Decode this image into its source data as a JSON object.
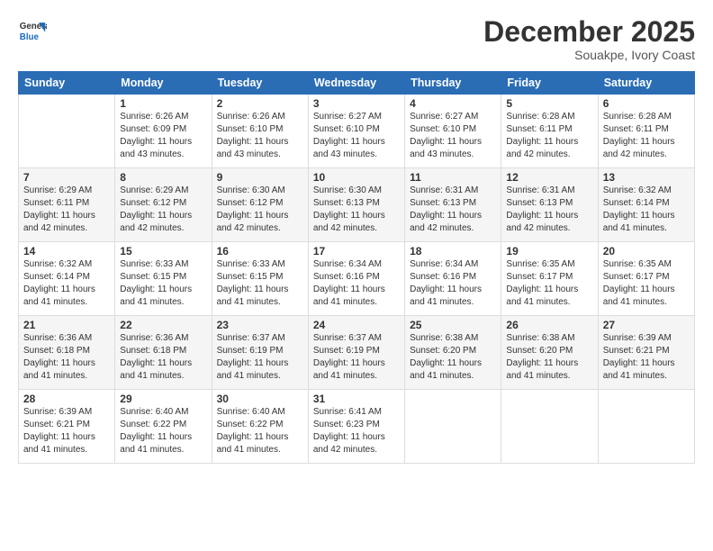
{
  "logo": {
    "general": "General",
    "blue": "Blue"
  },
  "title": "December 2025",
  "subtitle": "Souakpe, Ivory Coast",
  "headers": [
    "Sunday",
    "Monday",
    "Tuesday",
    "Wednesday",
    "Thursday",
    "Friday",
    "Saturday"
  ],
  "weeks": [
    [
      {
        "day": "",
        "info": ""
      },
      {
        "day": "1",
        "info": "Sunrise: 6:26 AM\nSunset: 6:09 PM\nDaylight: 11 hours\nand 43 minutes."
      },
      {
        "day": "2",
        "info": "Sunrise: 6:26 AM\nSunset: 6:10 PM\nDaylight: 11 hours\nand 43 minutes."
      },
      {
        "day": "3",
        "info": "Sunrise: 6:27 AM\nSunset: 6:10 PM\nDaylight: 11 hours\nand 43 minutes."
      },
      {
        "day": "4",
        "info": "Sunrise: 6:27 AM\nSunset: 6:10 PM\nDaylight: 11 hours\nand 43 minutes."
      },
      {
        "day": "5",
        "info": "Sunrise: 6:28 AM\nSunset: 6:11 PM\nDaylight: 11 hours\nand 42 minutes."
      },
      {
        "day": "6",
        "info": "Sunrise: 6:28 AM\nSunset: 6:11 PM\nDaylight: 11 hours\nand 42 minutes."
      }
    ],
    [
      {
        "day": "7",
        "info": "Sunrise: 6:29 AM\nSunset: 6:11 PM\nDaylight: 11 hours\nand 42 minutes."
      },
      {
        "day": "8",
        "info": "Sunrise: 6:29 AM\nSunset: 6:12 PM\nDaylight: 11 hours\nand 42 minutes."
      },
      {
        "day": "9",
        "info": "Sunrise: 6:30 AM\nSunset: 6:12 PM\nDaylight: 11 hours\nand 42 minutes."
      },
      {
        "day": "10",
        "info": "Sunrise: 6:30 AM\nSunset: 6:13 PM\nDaylight: 11 hours\nand 42 minutes."
      },
      {
        "day": "11",
        "info": "Sunrise: 6:31 AM\nSunset: 6:13 PM\nDaylight: 11 hours\nand 42 minutes."
      },
      {
        "day": "12",
        "info": "Sunrise: 6:31 AM\nSunset: 6:13 PM\nDaylight: 11 hours\nand 42 minutes."
      },
      {
        "day": "13",
        "info": "Sunrise: 6:32 AM\nSunset: 6:14 PM\nDaylight: 11 hours\nand 41 minutes."
      }
    ],
    [
      {
        "day": "14",
        "info": "Sunrise: 6:32 AM\nSunset: 6:14 PM\nDaylight: 11 hours\nand 41 minutes."
      },
      {
        "day": "15",
        "info": "Sunrise: 6:33 AM\nSunset: 6:15 PM\nDaylight: 11 hours\nand 41 minutes."
      },
      {
        "day": "16",
        "info": "Sunrise: 6:33 AM\nSunset: 6:15 PM\nDaylight: 11 hours\nand 41 minutes."
      },
      {
        "day": "17",
        "info": "Sunrise: 6:34 AM\nSunset: 6:16 PM\nDaylight: 11 hours\nand 41 minutes."
      },
      {
        "day": "18",
        "info": "Sunrise: 6:34 AM\nSunset: 6:16 PM\nDaylight: 11 hours\nand 41 minutes."
      },
      {
        "day": "19",
        "info": "Sunrise: 6:35 AM\nSunset: 6:17 PM\nDaylight: 11 hours\nand 41 minutes."
      },
      {
        "day": "20",
        "info": "Sunrise: 6:35 AM\nSunset: 6:17 PM\nDaylight: 11 hours\nand 41 minutes."
      }
    ],
    [
      {
        "day": "21",
        "info": "Sunrise: 6:36 AM\nSunset: 6:18 PM\nDaylight: 11 hours\nand 41 minutes."
      },
      {
        "day": "22",
        "info": "Sunrise: 6:36 AM\nSunset: 6:18 PM\nDaylight: 11 hours\nand 41 minutes."
      },
      {
        "day": "23",
        "info": "Sunrise: 6:37 AM\nSunset: 6:19 PM\nDaylight: 11 hours\nand 41 minutes."
      },
      {
        "day": "24",
        "info": "Sunrise: 6:37 AM\nSunset: 6:19 PM\nDaylight: 11 hours\nand 41 minutes."
      },
      {
        "day": "25",
        "info": "Sunrise: 6:38 AM\nSunset: 6:20 PM\nDaylight: 11 hours\nand 41 minutes."
      },
      {
        "day": "26",
        "info": "Sunrise: 6:38 AM\nSunset: 6:20 PM\nDaylight: 11 hours\nand 41 minutes."
      },
      {
        "day": "27",
        "info": "Sunrise: 6:39 AM\nSunset: 6:21 PM\nDaylight: 11 hours\nand 41 minutes."
      }
    ],
    [
      {
        "day": "28",
        "info": "Sunrise: 6:39 AM\nSunset: 6:21 PM\nDaylight: 11 hours\nand 41 minutes."
      },
      {
        "day": "29",
        "info": "Sunrise: 6:40 AM\nSunset: 6:22 PM\nDaylight: 11 hours\nand 41 minutes."
      },
      {
        "day": "30",
        "info": "Sunrise: 6:40 AM\nSunset: 6:22 PM\nDaylight: 11 hours\nand 41 minutes."
      },
      {
        "day": "31",
        "info": "Sunrise: 6:41 AM\nSunset: 6:23 PM\nDaylight: 11 hours\nand 42 minutes."
      },
      {
        "day": "",
        "info": ""
      },
      {
        "day": "",
        "info": ""
      },
      {
        "day": "",
        "info": ""
      }
    ]
  ]
}
